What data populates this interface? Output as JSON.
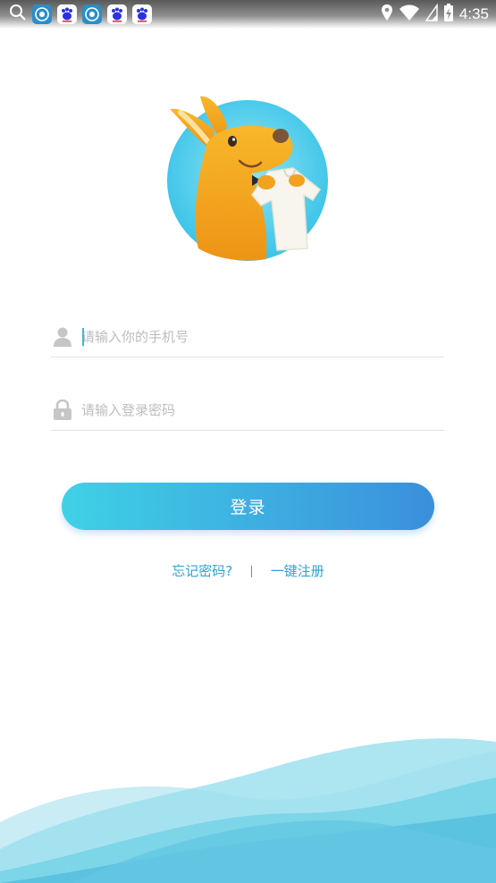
{
  "status_bar": {
    "time": "4:35",
    "notification_icons": [
      "search-icon",
      "fox-app-icon",
      "baidu-app-icon",
      "fox-app-icon",
      "baidu-app-icon",
      "baidu-app-icon"
    ],
    "status_icons": [
      "location-icon",
      "wifi-icon",
      "signal-icon",
      "battery-charging-icon"
    ]
  },
  "logo": {
    "mascot": "kangaroo-mascot",
    "colors": {
      "circle": "#5ad0ea",
      "body": "#f2a21e"
    }
  },
  "form": {
    "phone_placeholder": "请输入你的手机号",
    "password_placeholder": "请输入登录密码"
  },
  "login_button": {
    "label": "登录"
  },
  "links": {
    "forgot_password": "忘记密码?",
    "register": "一键注册"
  },
  "colors": {
    "accent": "#2ba3d8",
    "button_gradient_start": "#3fd1e6",
    "button_gradient_end": "#3b8fdc"
  }
}
